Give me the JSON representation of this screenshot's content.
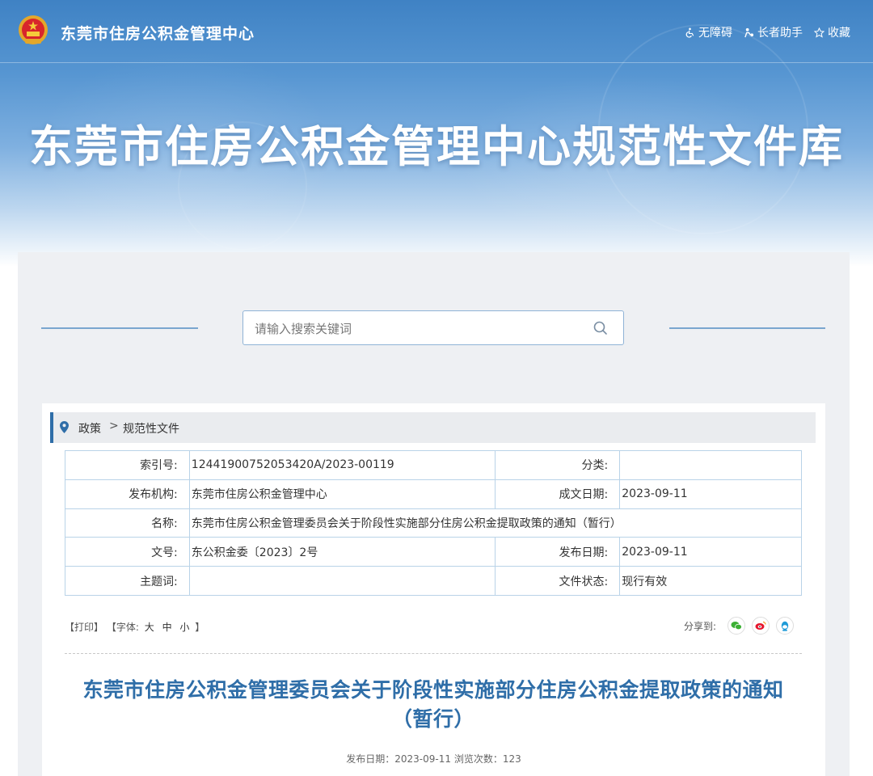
{
  "header": {
    "site_name": "东莞市住房公积金管理中心",
    "tools": [
      {
        "label": "无障碍",
        "icon": "wheelchair-icon"
      },
      {
        "label": "长者助手",
        "icon": "elder-icon"
      },
      {
        "label": "收藏",
        "icon": "star-icon"
      }
    ]
  },
  "hero": {
    "title": "东莞市住房公积金管理中心规范性文件库"
  },
  "search": {
    "placeholder": "请输入搜索关键词",
    "icon": "search-icon"
  },
  "breadcrumb": {
    "items": [
      "政策",
      "规范性文件"
    ],
    "separator": ">"
  },
  "meta": {
    "index_label": "索引号:",
    "index_value": "12441900752053420A/2023-00119",
    "category_label": "分类:",
    "category_value": "",
    "publisher_label": "发布机构:",
    "publisher_value": "东莞市住房公积金管理中心",
    "written_date_label": "成文日期:",
    "written_date_value": "2023-09-11",
    "name_label": "名称:",
    "name_value": "东莞市住房公积金管理委员会关于阶段性实施部分住房公积金提取政策的通知（暂行）",
    "doc_no_label": "文号:",
    "doc_no_value": "东公积金委〔2023〕2号",
    "pub_date_label": "发布日期:",
    "pub_date_value": "2023-09-11",
    "keywords_label": "主题词:",
    "keywords_value": "",
    "status_label": "文件状态:",
    "status_value": "现行有效"
  },
  "toolsrow": {
    "print": "【打印】",
    "font_prefix": "【字体:",
    "font_large": "大",
    "font_medium": "中",
    "font_small": "小",
    "font_suffix": "】"
  },
  "share": {
    "label": "分享到:",
    "icons": [
      "wechat-icon",
      "weibo-icon",
      "qq-icon"
    ]
  },
  "article": {
    "title": "东莞市住房公积金管理委员会关于阶段性实施部分住房公积金提取政策的通知（暂行）",
    "pub_info": "发布日期：2023-09-11  浏览次数：123"
  },
  "colors": {
    "brand": "#2f6ea8",
    "hero_top": "#3f82c4",
    "border": "#b9d3e8"
  }
}
